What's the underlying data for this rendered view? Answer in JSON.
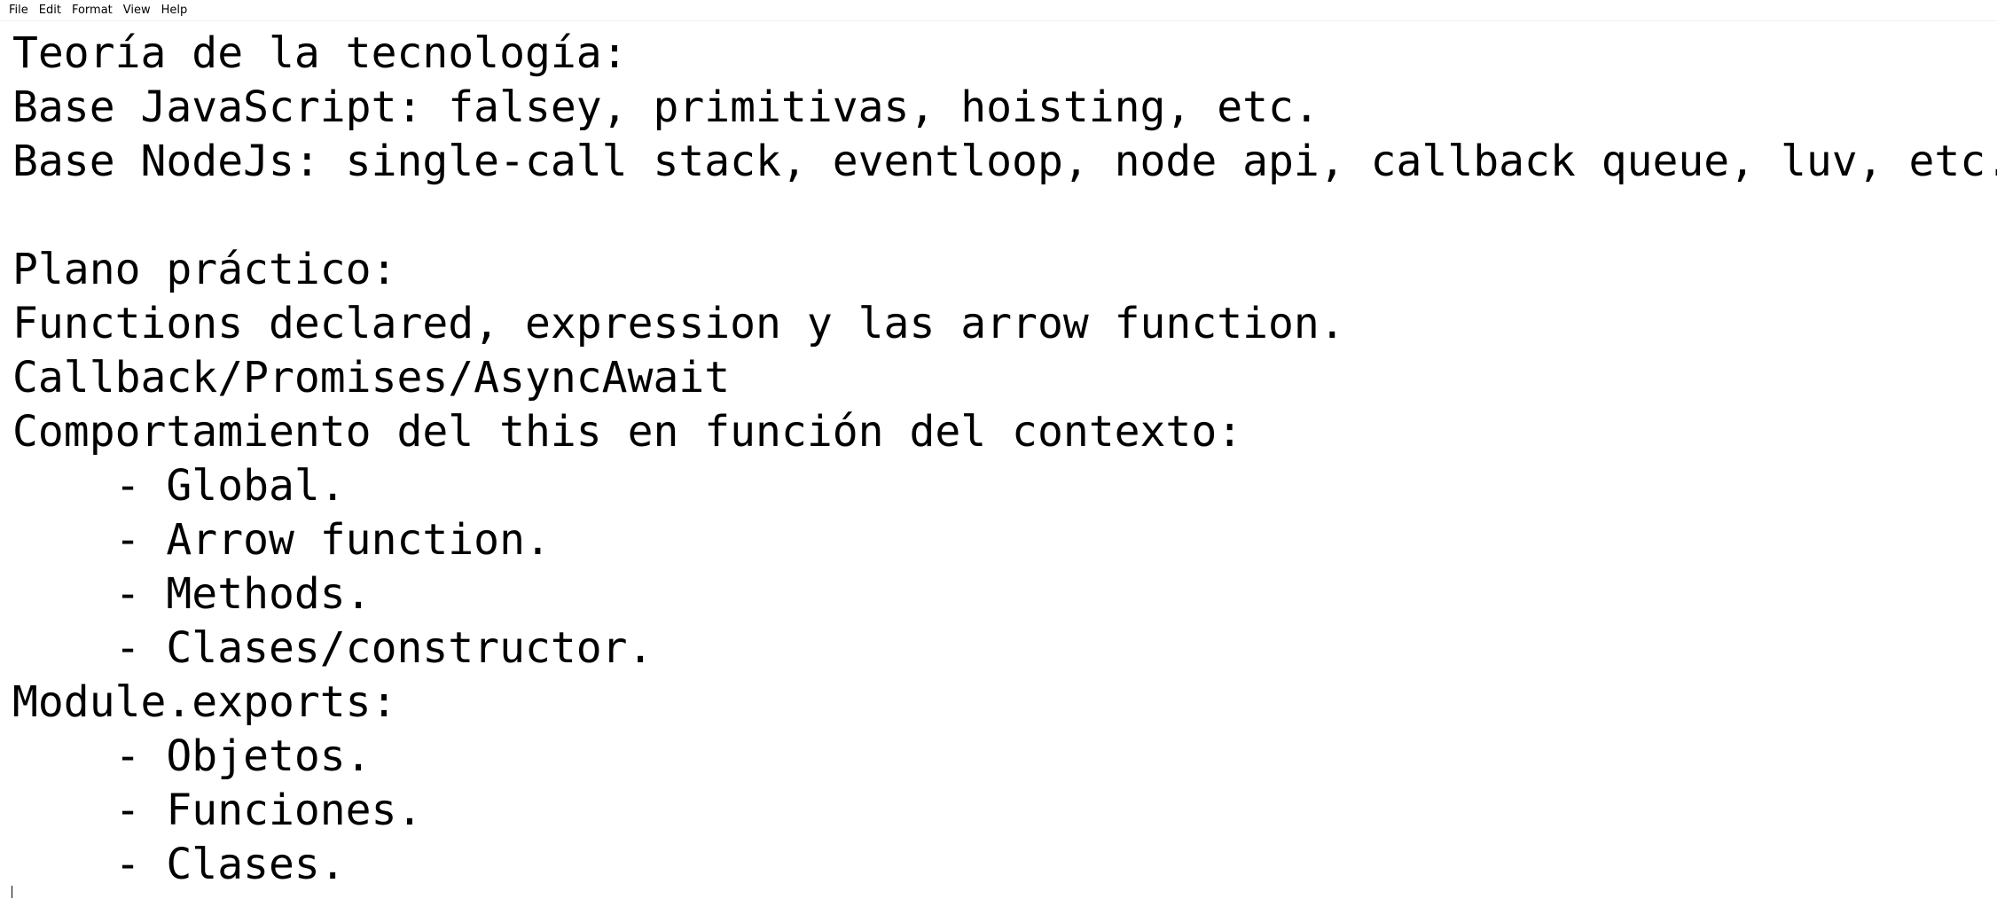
{
  "menu": {
    "items": [
      {
        "label": "File"
      },
      {
        "label": "Edit"
      },
      {
        "label": "Format"
      },
      {
        "label": "View"
      },
      {
        "label": "Help"
      }
    ]
  },
  "document": {
    "lines": [
      "Teoría de la tecnología:",
      "Base JavaScript: falsey, primitivas, hoisting, etc.",
      "Base NodeJs: single-call stack, eventloop, node api, callback queue, luv, etc.",
      "",
      "Plano práctico:",
      "Functions declared, expression y las arrow function.",
      "Callback/Promises/AsyncAwait",
      "Comportamiento del this en función del contexto:",
      "\t- Global.",
      "\t- Arrow function.",
      "\t- Methods.",
      "\t- Clases/constructor.",
      "Module.exports:",
      "\t- Objetos.",
      "\t- Funciones.",
      "\t- Clases."
    ]
  }
}
